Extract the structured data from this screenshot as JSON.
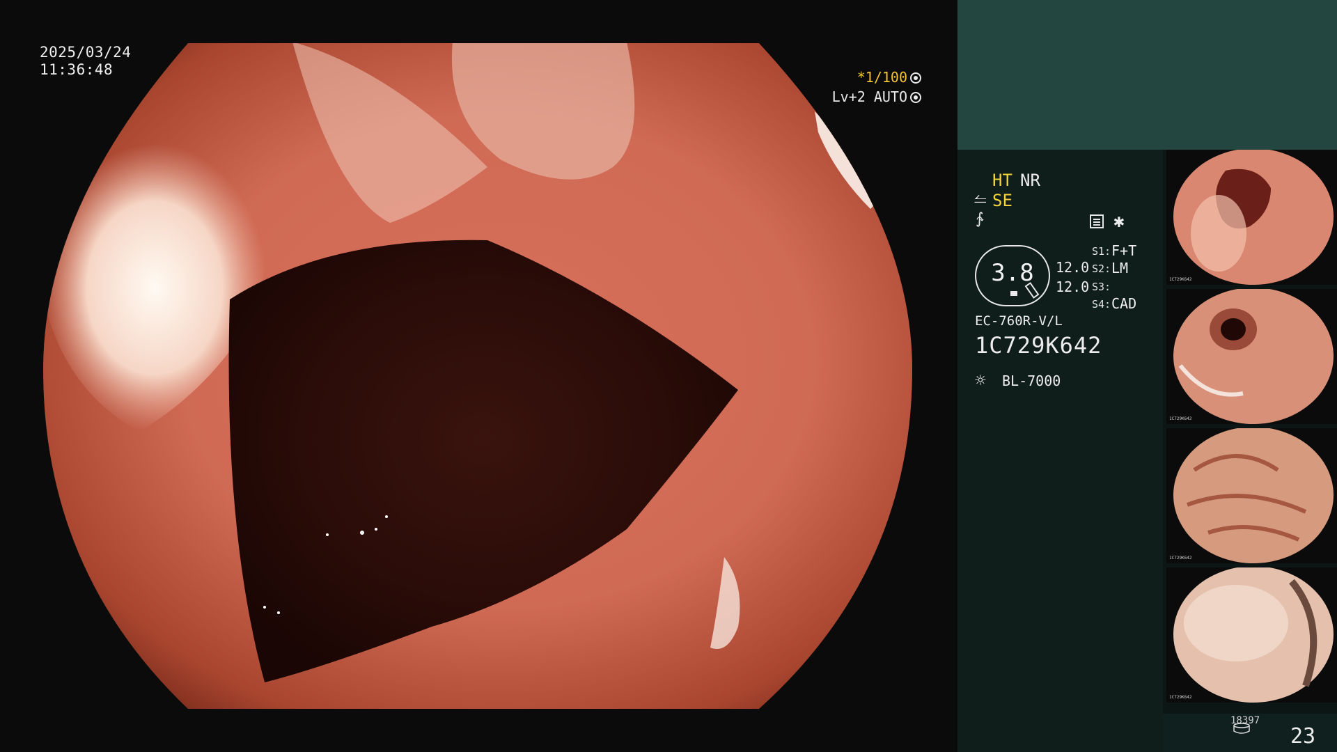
{
  "viewer": {
    "date": "2025/03/24",
    "time": "11:36:48",
    "shutter_label": "*1/100",
    "level_label": "Lv+2 AUTO"
  },
  "panel": {
    "mode_ht": "HT",
    "mode_nr": "NR",
    "mode_se": "SE",
    "gauge_value": "3.8",
    "values": [
      "12.0",
      "12.0"
    ],
    "switches": [
      {
        "label": "S1:",
        "value": "F+T"
      },
      {
        "label": "S2:",
        "value": "LM"
      },
      {
        "label": "S3:",
        "value": ""
      },
      {
        "label": "S4:",
        "value": "CAD"
      }
    ],
    "scope_model": "EC-760R-V/L",
    "scope_serial": "1C729K642",
    "light_source": "BL-7000",
    "counter_small": "18397",
    "image_count": "23",
    "icons": {
      "shutter": "aperture-icon",
      "level": "iris-icon",
      "se": "structure-enhance-icon",
      "struct": "sharpness-icon",
      "menu": "menu-icon",
      "light": "sun-icon",
      "counter": "storage-icon"
    },
    "thumbnails": [
      {
        "caption": "1C729K642"
      },
      {
        "caption": "1C729K642"
      },
      {
        "caption": "1C729K642"
      },
      {
        "caption": "1C729K642"
      }
    ]
  }
}
